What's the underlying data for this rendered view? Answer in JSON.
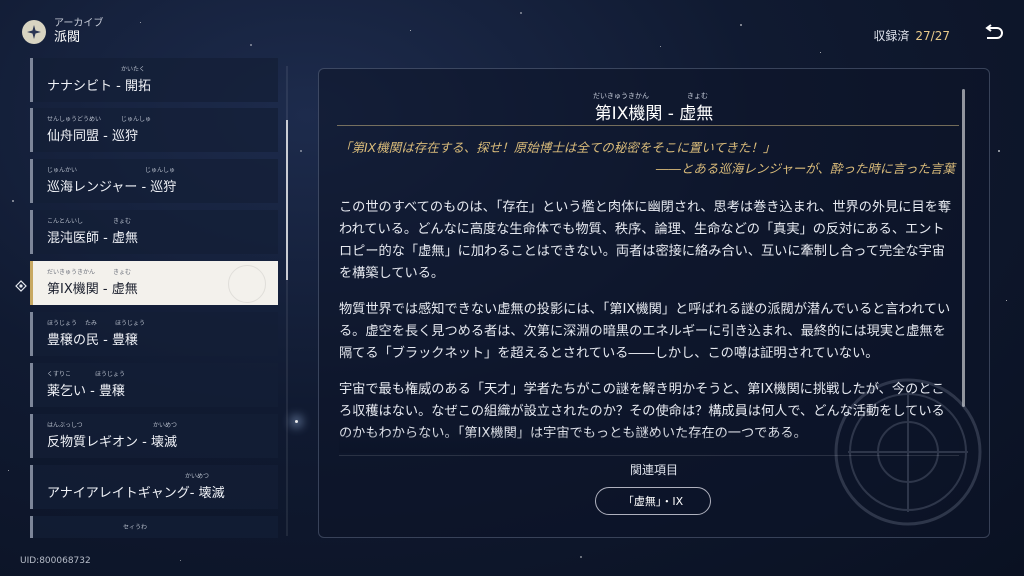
{
  "header": {
    "breadcrumb": "アーカイブ",
    "title": "派閥",
    "collected_label": "収録済",
    "collected_count": "27/27",
    "logo_icon": "archive-compass-icon",
    "back_icon": "return-arrow-icon"
  },
  "list": {
    "items": [
      {
        "label": "ナナシビト - 開拓",
        "ruby": [
          "かいたく"
        ],
        "selected": false
      },
      {
        "label": "仙舟同盟 - 巡狩",
        "ruby": [
          "せんしゅうどうめい",
          "じゅんしゅ"
        ],
        "selected": false
      },
      {
        "label": "巡海レンジャー - 巡狩",
        "ruby": [
          "じゅんかい",
          "じゅんしゅ"
        ],
        "selected": false
      },
      {
        "label": "混沌医師 - 虚無",
        "ruby": [
          "こんとんいし",
          "きょむ"
        ],
        "selected": false
      },
      {
        "label": "第IX機関 - 虚無",
        "ruby": [
          "だいきゅうきかん",
          "きょむ"
        ],
        "selected": true
      },
      {
        "label": "豊穣の民 - 豊穣",
        "ruby": [
          "ほうじょう",
          "たみ",
          "ほうじょう"
        ],
        "selected": false
      },
      {
        "label": "薬乞い - 豊穣",
        "ruby": [
          "くすりこ",
          "ほうじょう"
        ],
        "selected": false
      },
      {
        "label": "反物質レギオン - 壊滅",
        "ruby": [
          "はんぶっしつ",
          "かいめつ"
        ],
        "selected": false
      },
      {
        "label": "アナイアレイトギャング- 壊滅",
        "ruby": [
          "かいめつ"
        ],
        "selected": false
      },
      {
        "label": "",
        "ruby": [
          "セィうわ"
        ],
        "selected": false
      }
    ]
  },
  "detail": {
    "title": "第IX機関 - 虚無",
    "title_ruby_1": "だいきゅうきかん",
    "title_ruby_2": "きょむ",
    "quote_line1": "「第IX機関は存在する、探せ！原始博士は全ての秘密をそこに置いてきた！」",
    "quote_line2": "――とある巡海レンジャーが、酔った時に言った言葉",
    "paragraphs": [
      "この世のすべてのものは、「存在」という檻と肉体に幽閉され、思考は巻き込まれ、世界の外見に目を奪われている。どんなに高度な生命体でも物質、秩序、論理、生命などの「真実」の反対にある、エントロピー的な「虚無」に加わることはできない。両者は密接に絡み合い、互いに牽制し合って完全な宇宙を構築している。",
      "物質世界では感知できない虚無の投影には、「第IX機関」と呼ばれる謎の派閥が潜んでいると言われている。虚空を長く見つめる者は、次第に深淵の暗黒のエネルギーに引き込まれ、最終的には現実と虚無を隔てる「ブラックネット」を超えるとされている――しかし、この噂は証明されていない。",
      "宇宙で最も権威のある「天才」学者たちがこの謎を解き明かそうと、第IX機関に挑戦したが、今のところ収穫はない。なぜこの組織が設立されたのか？その使命は？構成員は何人で、どんな活動をしているのかもわからない。「第IX機関」は宇宙でもっとも謎めいた存在の一つである。"
    ],
    "related_label": "関連項目",
    "related_button": "「虚無」・IX"
  },
  "footer": {
    "uid": "UID:800068732"
  }
}
